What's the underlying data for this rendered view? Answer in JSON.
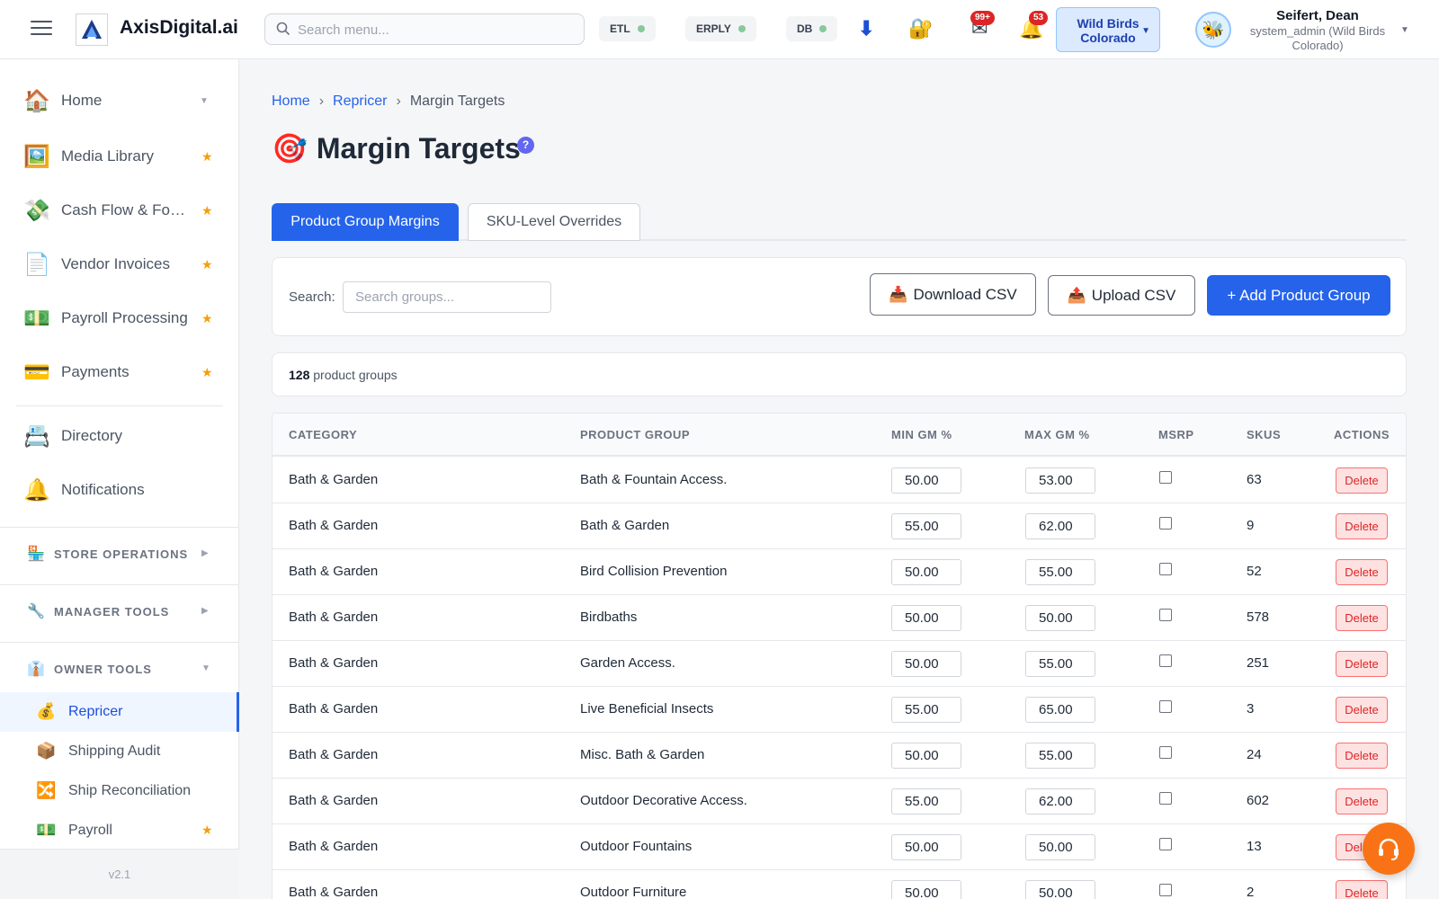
{
  "header": {
    "app_name": "AxisDigital.ai",
    "search_placeholder": "Search menu...",
    "status_pills": [
      {
        "label": "ETL"
      },
      {
        "label": "ERPLY"
      },
      {
        "label": "DB"
      }
    ],
    "messages_badge": "99+",
    "notifications_badge": "53",
    "store_line1": "Wild Birds",
    "store_line2": "Colorado",
    "user_name": "Seifert, Dean",
    "user_role": "system_admin (Wild Birds Colorado)"
  },
  "sidebar": {
    "items": [
      {
        "label": "Home",
        "icon": "🏠"
      },
      {
        "label": "Media Library",
        "icon": "🖼️"
      },
      {
        "label": "Cash Flow & Forecasting",
        "icon": "💸"
      },
      {
        "label": "Vendor Invoices",
        "icon": "📄"
      },
      {
        "label": "Payroll Processing",
        "icon": "💵"
      },
      {
        "label": "Payments",
        "icon": "💳"
      },
      {
        "label": "Directory",
        "icon": "📇"
      },
      {
        "label": "Notifications",
        "icon": "🔔"
      }
    ],
    "sections": [
      {
        "label": "STORE OPERATIONS",
        "icon": "🏪"
      },
      {
        "label": "MANAGER TOOLS",
        "icon": "🔧"
      },
      {
        "label": "OWNER TOOLS",
        "icon": "👔"
      }
    ],
    "sub_items": [
      {
        "label": "Repricer",
        "icon": "💰"
      },
      {
        "label": "Shipping Audit",
        "icon": "📦"
      },
      {
        "label": "Ship Reconciliation",
        "icon": "🔀"
      },
      {
        "label": "Payroll",
        "icon": "💵"
      }
    ],
    "version": "v2.1"
  },
  "breadcrumb": {
    "home": "Home",
    "repricer": "Repricer",
    "current": "Margin Targets"
  },
  "page": {
    "title": "Margin Targets",
    "title_icon": "🎯",
    "help": "?"
  },
  "tabs": {
    "active": "Product Group Margins",
    "inactive": "SKU-Level Overrides"
  },
  "toolbar": {
    "search_label": "Search:",
    "search_placeholder": "Search groups...",
    "download_label": "Download CSV",
    "upload_label": "Upload CSV",
    "add_label": "+ Add Product Group"
  },
  "summary": {
    "count": "128",
    "suffix": "product groups"
  },
  "table": {
    "headers": {
      "category": "CATEGORY",
      "product_group": "PRODUCT GROUP",
      "min_gm": "MIN GM %",
      "max_gm": "MAX GM %",
      "msrp": "MSRP",
      "skus": "SKUS",
      "actions": "ACTIONS"
    },
    "delete_label": "Delete",
    "rows": [
      {
        "category": "Bath & Garden",
        "group": "Bath & Fountain Access.",
        "min": "50.00",
        "max": "53.00",
        "msrp": false,
        "skus": "63"
      },
      {
        "category": "Bath & Garden",
        "group": "Bath & Garden",
        "min": "55.00",
        "max": "62.00",
        "msrp": false,
        "skus": "9"
      },
      {
        "category": "Bath & Garden",
        "group": "Bird Collision Prevention",
        "min": "50.00",
        "max": "55.00",
        "msrp": false,
        "skus": "52"
      },
      {
        "category": "Bath & Garden",
        "group": "Birdbaths",
        "min": "50.00",
        "max": "50.00",
        "msrp": false,
        "skus": "578"
      },
      {
        "category": "Bath & Garden",
        "group": "Garden Access.",
        "min": "50.00",
        "max": "55.00",
        "msrp": false,
        "skus": "251"
      },
      {
        "category": "Bath & Garden",
        "group": "Live Beneficial Insects",
        "min": "55.00",
        "max": "65.00",
        "msrp": false,
        "skus": "3"
      },
      {
        "category": "Bath & Garden",
        "group": "Misc. Bath & Garden",
        "min": "50.00",
        "max": "55.00",
        "msrp": false,
        "skus": "24"
      },
      {
        "category": "Bath & Garden",
        "group": "Outdoor Decorative Access.",
        "min": "55.00",
        "max": "62.00",
        "msrp": false,
        "skus": "602"
      },
      {
        "category": "Bath & Garden",
        "group": "Outdoor Fountains",
        "min": "50.00",
        "max": "50.00",
        "msrp": false,
        "skus": "13"
      },
      {
        "category": "Bath & Garden",
        "group": "Outdoor Furniture",
        "min": "50.00",
        "max": "50.00",
        "msrp": false,
        "skus": "2"
      }
    ]
  },
  "colors": {
    "primary": "#2563eb",
    "danger": "#dc2626",
    "fab": "#f97316"
  }
}
